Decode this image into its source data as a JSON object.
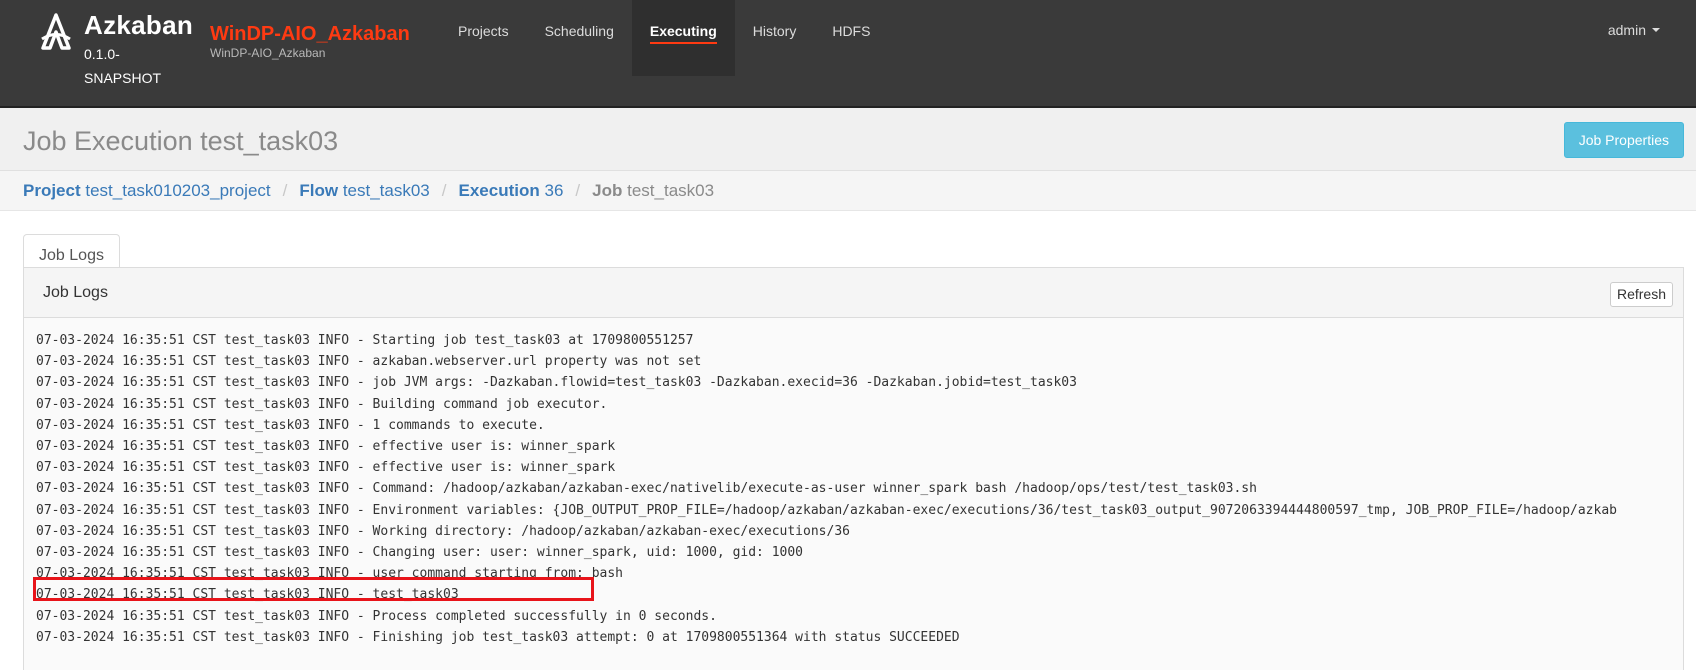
{
  "brand": {
    "name": "Azkaban",
    "version": "0.1.0-SNAPSHOT",
    "logo_icon": "azkaban-logo-icon"
  },
  "cluster": {
    "name": "WinDP-AIO_Azkaban",
    "subtitle": "WinDP-AIO_Azkaban"
  },
  "nav": {
    "items": [
      {
        "label": "Projects"
      },
      {
        "label": "Scheduling"
      },
      {
        "label": "Executing",
        "active": true
      },
      {
        "label": "History"
      },
      {
        "label": "HDFS"
      }
    ],
    "user": "admin"
  },
  "header": {
    "title": "Job Execution test_task03",
    "job_properties_label": "Job Properties"
  },
  "breadcrumb": {
    "project_label": "Project",
    "project_value": "test_task010203_project",
    "flow_label": "Flow",
    "flow_value": "test_task03",
    "execution_label": "Execution",
    "execution_value": "36",
    "job_label": "Job",
    "job_value": "test_task03"
  },
  "tab": {
    "label": "Job Logs"
  },
  "panel": {
    "title": "Job Logs",
    "refresh_label": "Refresh"
  },
  "logs": [
    "07-03-2024 16:35:51 CST test_task03 INFO - Starting job test_task03 at 1709800551257",
    "07-03-2024 16:35:51 CST test_task03 INFO - azkaban.webserver.url property was not set",
    "07-03-2024 16:35:51 CST test_task03 INFO - job JVM args: -Dazkaban.flowid=test_task03 -Dazkaban.execid=36 -Dazkaban.jobid=test_task03",
    "07-03-2024 16:35:51 CST test_task03 INFO - Building command job executor.",
    "07-03-2024 16:35:51 CST test_task03 INFO - 1 commands to execute.",
    "07-03-2024 16:35:51 CST test_task03 INFO - effective user is: winner_spark",
    "07-03-2024 16:35:51 CST test_task03 INFO - effective user is: winner_spark",
    "07-03-2024 16:35:51 CST test_task03 INFO - Command: /hadoop/azkaban/azkaban-exec/nativelib/execute-as-user winner_spark bash /hadoop/ops/test/test_task03.sh",
    "07-03-2024 16:35:51 CST test_task03 INFO - Environment variables: {JOB_OUTPUT_PROP_FILE=/hadoop/azkaban/azkaban-exec/executions/36/test_task03_output_9072063394444800597_tmp, JOB_PROP_FILE=/hadoop/azkab",
    "07-03-2024 16:35:51 CST test_task03 INFO - Working directory: /hadoop/azkaban/azkaban-exec/executions/36",
    "07-03-2024 16:35:51 CST test_task03 INFO - Changing user: user: winner_spark, uid: 1000, gid: 1000",
    "07-03-2024 16:35:51 CST test_task03 INFO - user command starting from: bash",
    "07-03-2024 16:35:51 CST test_task03 INFO - test_task03",
    "07-03-2024 16:35:51 CST test_task03 INFO - Process completed successfully in 0 seconds.",
    "07-03-2024 16:35:51 CST test_task03 INFO - Finishing job test_task03 attempt: 0 at 1709800551364 with status SUCCEEDED"
  ],
  "colors": {
    "navbar": "#3a3a3a",
    "accent": "#ff3a12",
    "link": "#3a7ab8",
    "info_button": "#5bc0de",
    "highlight": "#e8141a"
  }
}
